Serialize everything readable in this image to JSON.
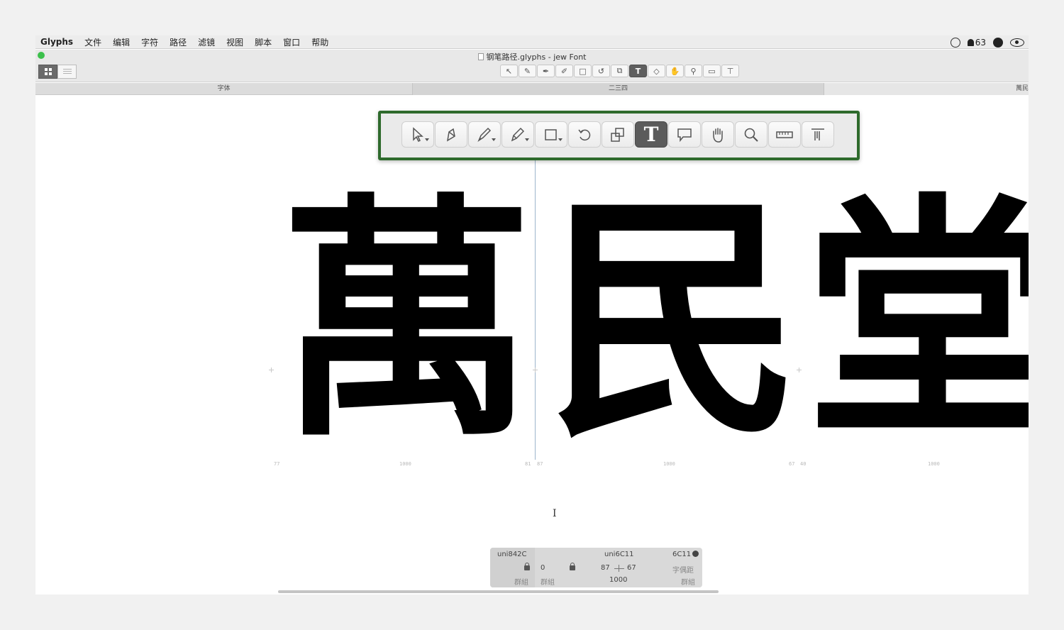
{
  "menubar": {
    "app_name": "Glyphs",
    "items": [
      "文件",
      "编辑",
      "字符",
      "路径",
      "滤镜",
      "视图",
      "脚本",
      "窗口",
      "帮助"
    ],
    "notification_count": "63"
  },
  "window": {
    "title": "钢笔路径.glyphs - jew Font"
  },
  "tabs": {
    "font_tab": "字体",
    "edit_tab": "二三四",
    "third_tab": "萬民"
  },
  "toolbar": {
    "tools": [
      "select-tool",
      "draw-tool",
      "pen-tool",
      "pencil-tool",
      "rectangle-tool",
      "rotate-tool",
      "scale-tool",
      "text-tool",
      "annotation-tool",
      "hand-tool",
      "zoom-tool",
      "measurement-tool",
      "metrics-tool"
    ],
    "active_tool": "text-tool",
    "text_tool_label": "T"
  },
  "canvas": {
    "glyphs": [
      "萬",
      "民",
      "堂"
    ],
    "metrics": {
      "g1_lsb": "77",
      "g1_width": "1000",
      "g1_rsb": "81",
      "g2_lsb": "87",
      "g2_width": "1000",
      "g2_rsb": "67",
      "g3_lsb": "40",
      "g3_width": "1000"
    }
  },
  "infobox": {
    "prev_glyph": "uni842C",
    "glyph_name": "uni6C11",
    "unicode": "6C11",
    "left_group_value": "0",
    "lsb": "87",
    "rsb": "67",
    "width": "1000",
    "group_label_1": "群組",
    "group_label_2": "群組",
    "group_label_3": "群組",
    "kerning_label": "字偶距"
  },
  "colors": {
    "callout_border": "#2e6a2c",
    "traffic_light": "#3cc04b",
    "metric_line": "#9db5cc"
  }
}
